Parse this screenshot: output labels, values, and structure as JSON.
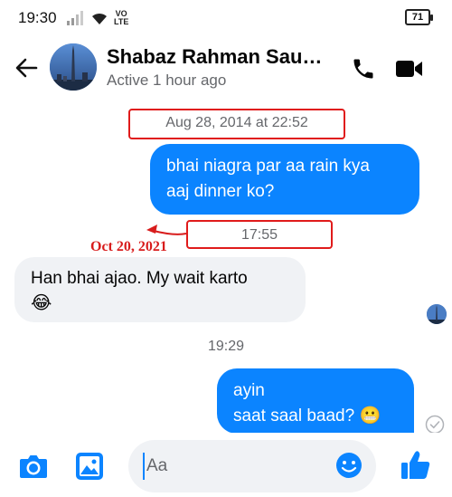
{
  "status_bar": {
    "time": "19:30",
    "volte_top": "VO",
    "volte_bottom": "LTE",
    "battery": "71",
    "icons": [
      "signal-icon",
      "wifi-icon",
      "battery-icon"
    ]
  },
  "header": {
    "contact_name": "Shabaz Rahman Saud…",
    "contact_status": "Active 1 hour ago",
    "icons": [
      "back-arrow-icon",
      "phone-icon",
      "video-camera-icon"
    ]
  },
  "messages": [
    {
      "type": "timestamp",
      "text": "Aug 28, 2014 at 22:52"
    },
    {
      "type": "outgoing",
      "lines": [
        "bhai niagra par aa rain kya",
        "aaj dinner ko?"
      ]
    },
    {
      "type": "timestamp",
      "text": "17:55"
    },
    {
      "type": "incoming",
      "lines": [
        "Han bhai ajao. My wait karto"
      ],
      "emoji": "😂"
    },
    {
      "type": "timestamp",
      "text": "19:29"
    },
    {
      "type": "outgoing",
      "lines": [
        "ayin",
        "saat saal baad?"
      ],
      "emoji": "😬"
    }
  ],
  "annotation": {
    "text": "Oct 20, 2021",
    "color": "#d81c1c"
  },
  "composer": {
    "placeholder": "Aa",
    "icons": [
      "camera-icon",
      "gallery-icon",
      "emoji-icon",
      "thumbs-up-icon"
    ]
  },
  "colors": {
    "accent": "#0b84ff",
    "incoming_bubble": "#f0f2f5",
    "annotation_red": "#e01b1b"
  }
}
